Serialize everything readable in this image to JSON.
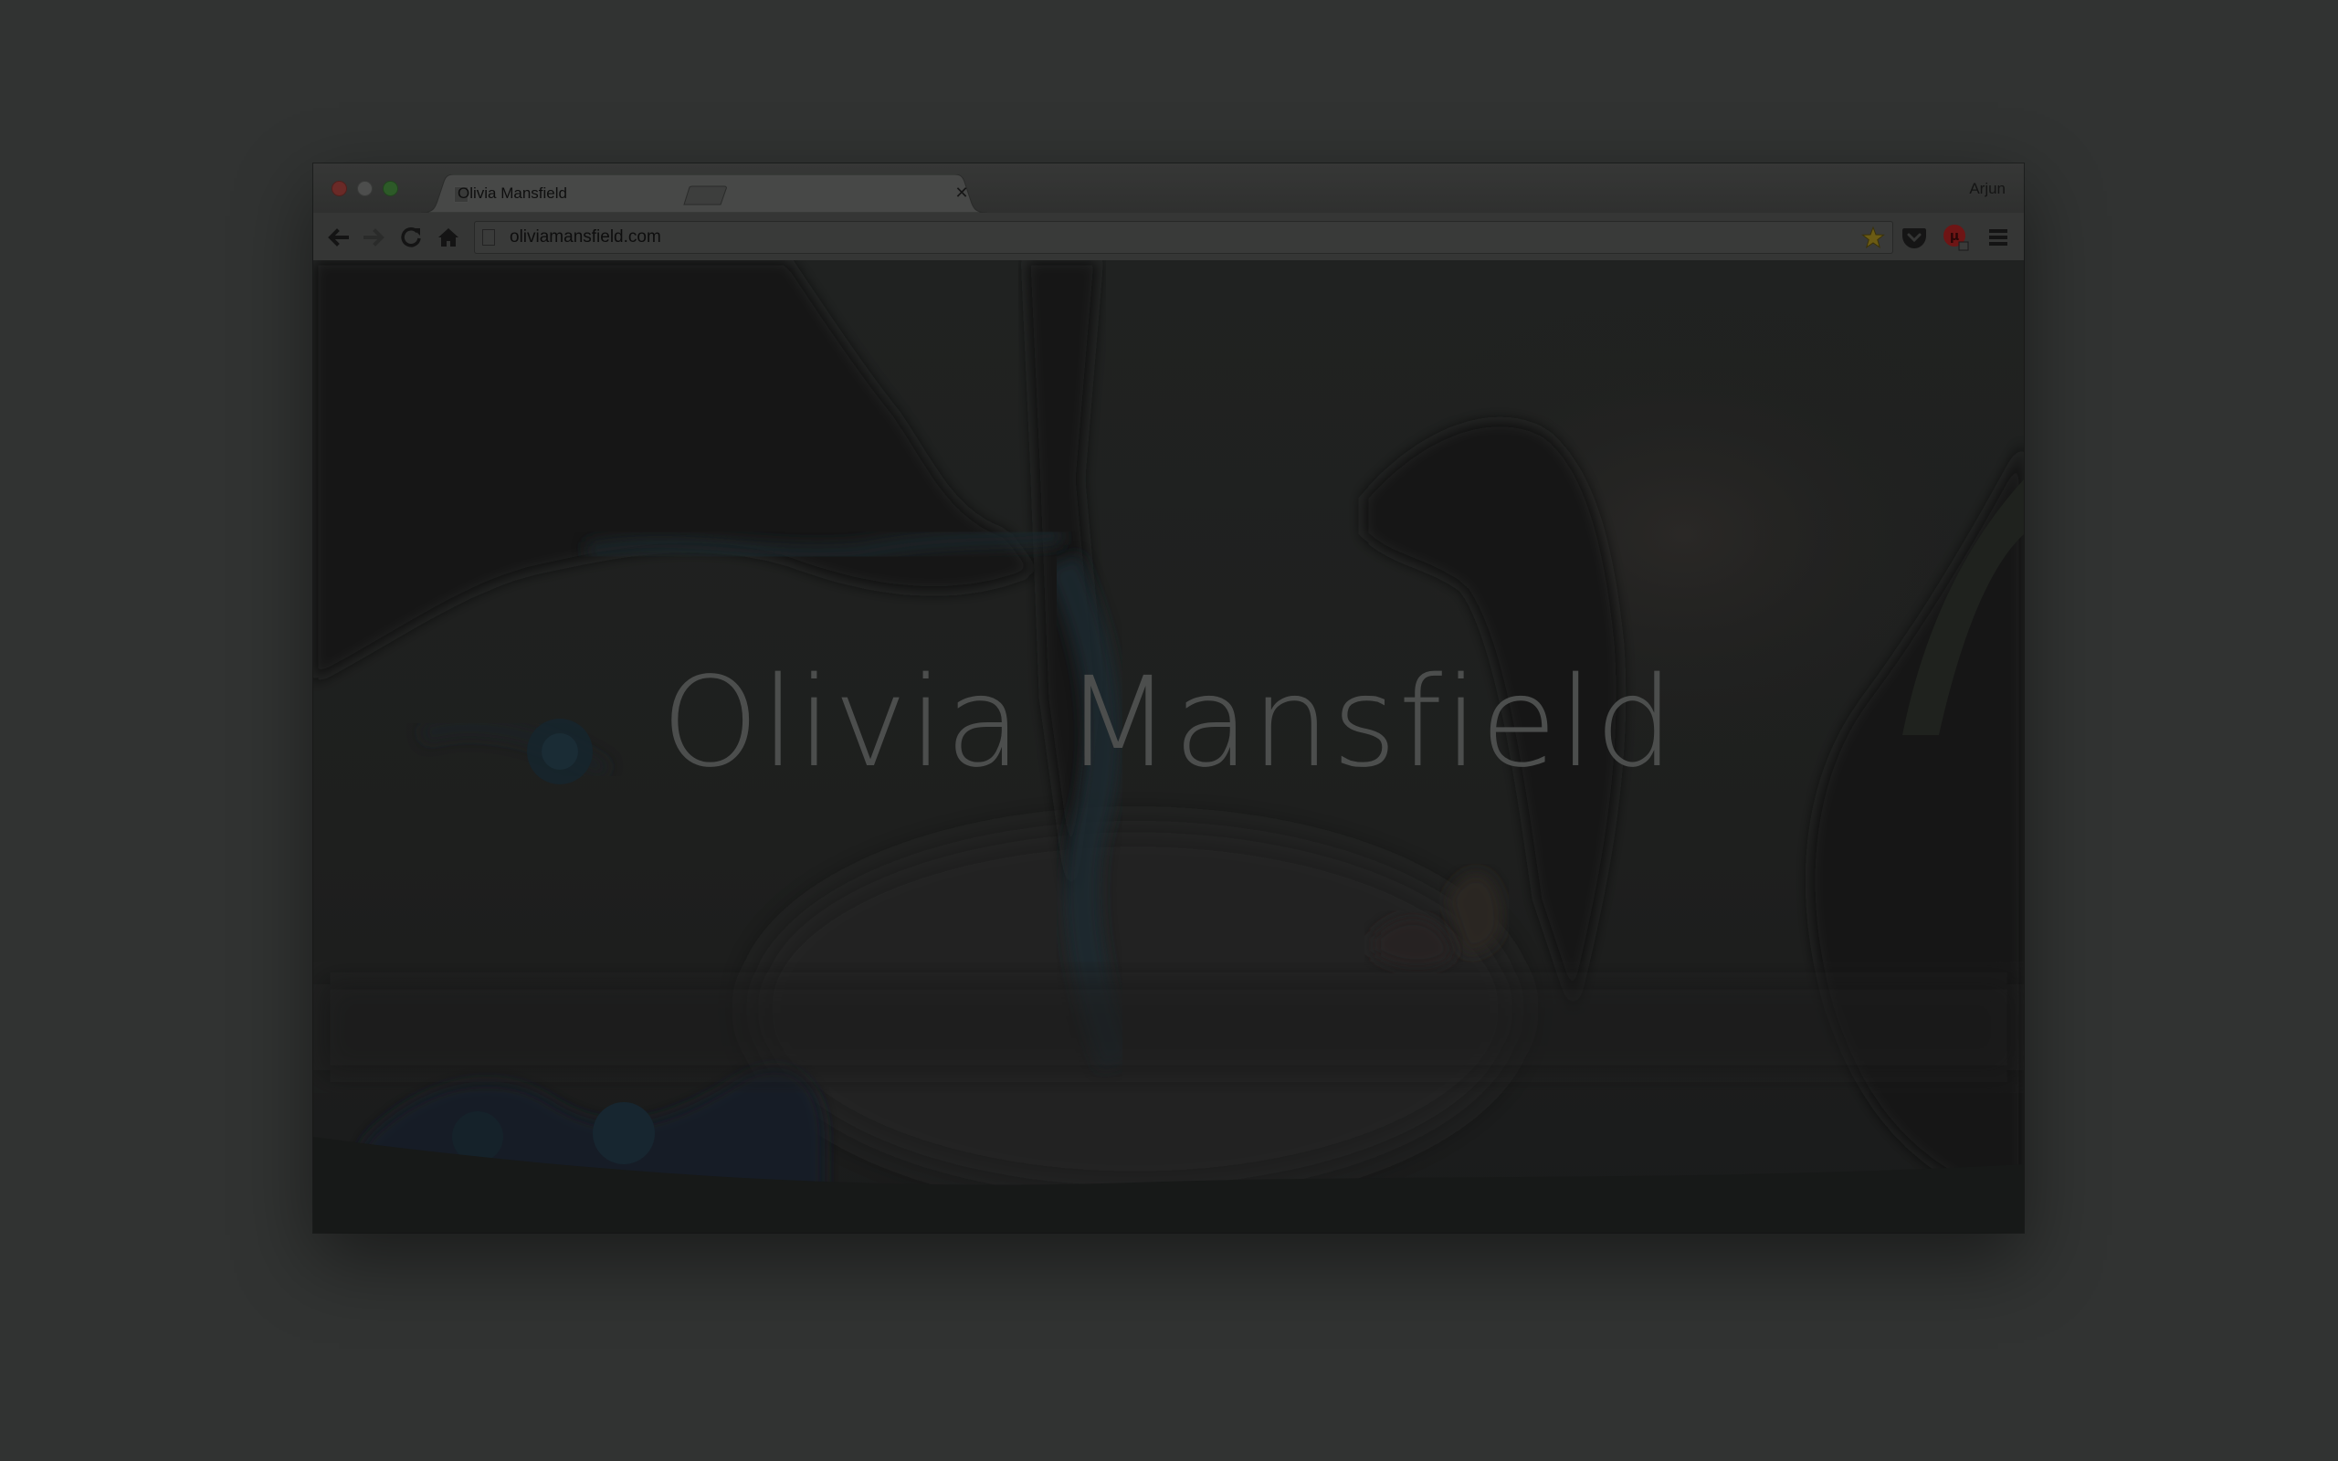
{
  "browser": {
    "tab": {
      "title": "Olivia Mansfield"
    },
    "profile_name": "Arjun",
    "address_bar": {
      "url": "oliviamansfield.com"
    },
    "icons": {
      "back": "arrow-left-icon",
      "forward": "arrow-right-icon",
      "reload": "reload-icon",
      "home": "home-icon",
      "bookmark": "star-icon",
      "pocket": "pocket-icon",
      "ublock": "ublock-origin-icon",
      "menu": "hamburger-menu-icon"
    },
    "colors": {
      "chrome_frame": "#363736",
      "toolbar": "#353635",
      "star": "#6b5b14",
      "ublock": "#6e1515"
    }
  },
  "page": {
    "hero_title": "Olivia Mansfield",
    "overlay": "dimmed"
  }
}
